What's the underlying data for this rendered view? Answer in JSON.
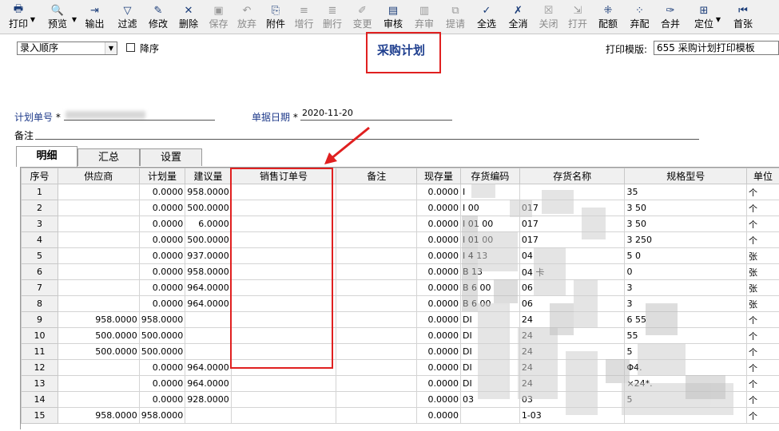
{
  "toolbar": {
    "buttons": [
      {
        "label": "打印",
        "icon": "printer-icon",
        "caret": true,
        "disabled": false
      },
      {
        "label": "预览",
        "icon": "preview-icon",
        "caret": true,
        "disabled": false
      },
      {
        "label": "输出",
        "icon": "export-icon",
        "caret": false,
        "disabled": false
      },
      {
        "label": "过滤",
        "icon": "filter-icon",
        "caret": false,
        "disabled": false
      },
      {
        "label": "修改",
        "icon": "edit-icon",
        "caret": false,
        "disabled": false
      },
      {
        "label": "删除",
        "icon": "delete-icon",
        "caret": false,
        "disabled": false
      },
      {
        "label": "保存",
        "icon": "save-icon",
        "caret": false,
        "disabled": true
      },
      {
        "label": "放弃",
        "icon": "undo-icon",
        "caret": false,
        "disabled": true
      },
      {
        "label": "附件",
        "icon": "attachment-icon",
        "caret": false,
        "disabled": false
      },
      {
        "label": "增行",
        "icon": "add-row-icon",
        "caret": false,
        "disabled": true
      },
      {
        "label": "删行",
        "icon": "delete-row-icon",
        "caret": false,
        "disabled": true
      },
      {
        "label": "变更",
        "icon": "change-icon",
        "caret": false,
        "disabled": true
      },
      {
        "label": "审核",
        "icon": "audit-icon",
        "caret": false,
        "disabled": false
      },
      {
        "label": "弃审",
        "icon": "unaudit-icon",
        "caret": false,
        "disabled": true
      },
      {
        "label": "提请",
        "icon": "submit-icon",
        "caret": false,
        "disabled": true
      },
      {
        "label": "全选",
        "icon": "select-all-icon",
        "caret": false,
        "disabled": false
      },
      {
        "label": "全消",
        "icon": "deselect-all-icon",
        "caret": false,
        "disabled": false
      },
      {
        "label": "关闭",
        "icon": "close-doc-icon",
        "caret": false,
        "disabled": true
      },
      {
        "label": "打开",
        "icon": "open-doc-icon",
        "caret": false,
        "disabled": true
      },
      {
        "label": "配额",
        "icon": "quota-icon",
        "caret": false,
        "disabled": false
      },
      {
        "label": "弃配",
        "icon": "unquota-icon",
        "caret": false,
        "disabled": false
      },
      {
        "label": "合并",
        "icon": "merge-icon",
        "caret": false,
        "disabled": false
      },
      {
        "label": "定位",
        "icon": "locate-icon",
        "caret": true,
        "disabled": false
      },
      {
        "label": "首张",
        "icon": "first-record-icon",
        "caret": false,
        "disabled": false
      }
    ]
  },
  "header": {
    "sort_select": "录入顺序",
    "desc_label": "降序",
    "title": "采购计划",
    "template_label": "打印模版:",
    "template_value": "655 采购计划打印模板"
  },
  "form": {
    "plan_no_label": "计划单号",
    "date_label": "单据日期",
    "date_value": "2020-11-20",
    "remark_label": "备注",
    "required_mark": "*"
  },
  "tabs": [
    "明细",
    "汇总",
    "设置"
  ],
  "table": {
    "columns": [
      "序号",
      "供应商",
      "计划量",
      "建议量",
      "销售订单号",
      "备注",
      "现存量",
      "存货编码",
      "存货名称",
      "规格型号",
      "单位"
    ],
    "rows": [
      [
        "1",
        "",
        "0.0000",
        "958.0000",
        "",
        "",
        "0.0000",
        "I",
        "",
        "35",
        "个"
      ],
      [
        "2",
        "",
        "0.0000",
        "500.0000",
        "",
        "",
        "0.0000",
        "I          00",
        "017",
        "3   50",
        "个"
      ],
      [
        "3",
        "",
        "0.0000",
        "6.0000",
        "",
        "",
        "0.0000",
        "I  01      00",
        "017",
        "3   50",
        "个"
      ],
      [
        "4",
        "",
        "0.0000",
        "500.0000",
        "",
        "",
        "0.0000",
        "I  01      00",
        "017",
        "3  250",
        "个"
      ],
      [
        "5",
        "",
        "0.0000",
        "937.0000",
        "",
        "",
        "0.0000",
        "I    4     13",
        "04",
        "5   0",
        "张"
      ],
      [
        "6",
        "",
        "0.0000",
        "958.0000",
        "",
        "",
        "0.0000",
        "B         13",
        "04          卡",
        "0",
        "张"
      ],
      [
        "7",
        "",
        "0.0000",
        "964.0000",
        "",
        "",
        "0.0000",
        "B    6     00",
        "06",
        "3",
        "张"
      ],
      [
        "8",
        "",
        "0.0000",
        "964.0000",
        "",
        "",
        "0.0000",
        "B    6     00",
        "06",
        "3",
        "张"
      ],
      [
        "9",
        "958.0000",
        "958.0000",
        "",
        "",
        "",
        "0.0000",
        "DI",
        "24",
        "6   55",
        "个"
      ],
      [
        "10",
        "500.0000",
        "500.0000",
        "",
        "",
        "",
        "0.0000",
        "DI",
        "24",
        "55",
        "个"
      ],
      [
        "11",
        "500.0000",
        "500.0000",
        "",
        "",
        "",
        "0.0000",
        "DI",
        "24",
        "5",
        "个"
      ],
      [
        "12",
        "",
        "0.0000",
        "964.0000",
        "",
        "",
        "0.0000",
        "DI",
        "24",
        "Φ4.",
        "个"
      ],
      [
        "13",
        "",
        "0.0000",
        "964.0000",
        "",
        "",
        "0.0000",
        "DI",
        "24",
        "×24*.",
        "个"
      ],
      [
        "14",
        "",
        "0.0000",
        "928.0000",
        "",
        "",
        "0.0000",
        "   03",
        "03",
        "5",
        "个"
      ],
      [
        "15",
        "958.0000",
        "958.0000",
        "",
        "",
        "",
        "0.0000",
        "",
        "1-03",
        "",
        "个"
      ]
    ]
  },
  "colors": {
    "highlight_red": "#e02020",
    "title_blue": "#1f3f8f",
    "label_blue": "#1e3a8a",
    "toolbar_bg": "#f0f0f0"
  }
}
